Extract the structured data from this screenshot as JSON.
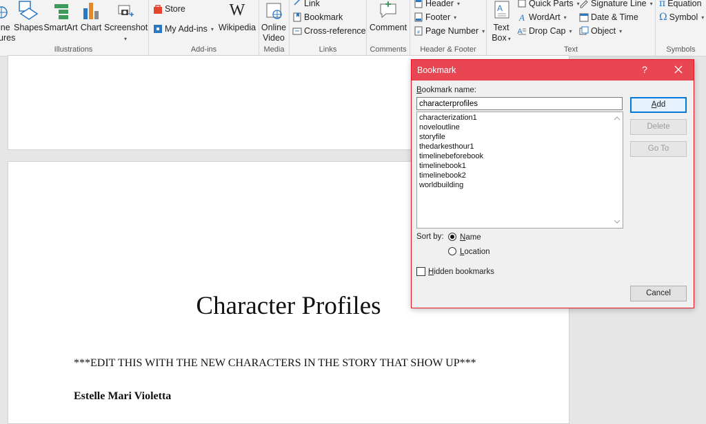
{
  "ribbon": {
    "illustrations": {
      "online_pictures_label_a": "ine",
      "online_pictures_label_b": "ures",
      "shapes_label": "Shapes",
      "smartart_label": "SmartArt",
      "chart_label": "Chart",
      "screenshot_label": "Screenshot",
      "group_label": "Illustrations"
    },
    "addins": {
      "store_label": "Store",
      "my_addins_label": "My Add-ins",
      "wikipedia_label": "Wikipedia",
      "group_label": "Add-ins"
    },
    "media": {
      "online_video_label_a": "Online",
      "online_video_label_b": "Video",
      "group_label": "Media"
    },
    "links": {
      "link_label": "Link",
      "bookmark_label": "Bookmark",
      "crossref_label": "Cross-reference",
      "group_label": "Links"
    },
    "comments": {
      "comment_label": "Comment",
      "group_label": "Comments"
    },
    "header_footer": {
      "header_label": "Header",
      "footer_label": "Footer",
      "page_number_label": "Page Number",
      "group_label": "Header & Footer"
    },
    "text": {
      "textbox_label_a": "Text",
      "textbox_label_b": "Box",
      "quick_parts_label": "Quick Parts",
      "wordart_label": "WordArt",
      "dropcap_label": "Drop Cap",
      "signature_label": "Signature Line",
      "datetime_label": "Date & Time",
      "object_label": "Object",
      "group_label": "Text"
    },
    "symbols": {
      "equation_label": "Equation",
      "symbol_label": "Symbol",
      "group_label": "Symbols"
    }
  },
  "document": {
    "title": "Character Profiles",
    "note": "***EDIT THIS WITH THE NEW CHARACTERS IN THE STORY THAT SHOW UP***",
    "first_name": "Estelle Mari Violetta"
  },
  "dialog": {
    "title": "Bookmark",
    "help": "?",
    "name_label_first": "B",
    "name_label_rest": "ookmark name:",
    "name_value": "characterprofiles",
    "bookmarks": [
      "characterization1",
      "noveloutline",
      "storyfile",
      "thedarkesthour1",
      "timelinebeforebook",
      "timelinebook1",
      "timelinebook2",
      "worldbuilding"
    ],
    "add_label_first": "A",
    "add_label_rest": "dd",
    "delete_label": "Delete",
    "goto_label": "Go To",
    "sort_by_label": "Sort by:",
    "sort_name_first": "N",
    "sort_name_rest": "ame",
    "sort_location_first": "L",
    "sort_location_rest": "ocation",
    "sort_selected": "Name",
    "hidden_first": "H",
    "hidden_rest": "idden bookmarks",
    "hidden_checked": false,
    "cancel_label": "Cancel"
  },
  "colors": {
    "dialog_titlebar": "#e84652",
    "dialog_border": "#e81123",
    "accent_blue": "#0078d7",
    "ribbon_bg": "#f3f3f3"
  }
}
